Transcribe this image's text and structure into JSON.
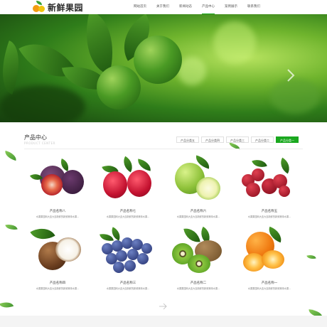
{
  "header": {
    "logo_text": "新鲜果园",
    "nav": [
      {
        "label": "网站首页",
        "active": false
      },
      {
        "label": "关于我们",
        "active": false
      },
      {
        "label": "新闻动态",
        "active": false
      },
      {
        "label": "产品中心",
        "active": true
      },
      {
        "label": "案例展示",
        "active": false
      },
      {
        "label": "联系我们",
        "active": false
      }
    ]
  },
  "banner": {
    "next_icon": "chevron-right-icon"
  },
  "products": {
    "title": "产品中心",
    "subtitle": "PRODUCT CENTER",
    "tabs": [
      {
        "label": "产品分类五",
        "active": false
      },
      {
        "label": "产品分类四",
        "active": false
      },
      {
        "label": "产品分类三",
        "active": false
      },
      {
        "label": "产品分类二",
        "active": false
      },
      {
        "label": "产品分类一",
        "active": true
      }
    ],
    "items": [
      {
        "name": "产品名称八",
        "desc": "水果果园网大连大连新鲜的新鲜美味水果...",
        "fruit": "fig"
      },
      {
        "name": "产品名称七",
        "desc": "水果果园网大连大连新鲜的新鲜美味水果...",
        "fruit": "raspberry"
      },
      {
        "name": "产品名称六",
        "desc": "水果果园网大连大连新鲜的新鲜美味水果...",
        "fruit": "apple"
      },
      {
        "name": "产品名称五",
        "desc": "水果果园网大连大连新鲜的新鲜美味水果...",
        "fruit": "cherry"
      },
      {
        "name": "产品名称四",
        "desc": "水果果园网大连大连新鲜的新鲜美味水果...",
        "fruit": "coconut"
      },
      {
        "name": "产品名称三",
        "desc": "水果果园网大连大连新鲜的新鲜美味水果...",
        "fruit": "blueberry"
      },
      {
        "name": "产品名称二",
        "desc": "水果果园网大连大连新鲜的新鲜美味水果...",
        "fruit": "kiwi"
      },
      {
        "name": "产品名称一",
        "desc": "水果果园网大连大连新鲜的新鲜美味水果...",
        "fruit": "orange"
      }
    ],
    "pager_icon": "arrow-right-icon"
  },
  "colors": {
    "accent": "#1aa81f"
  }
}
